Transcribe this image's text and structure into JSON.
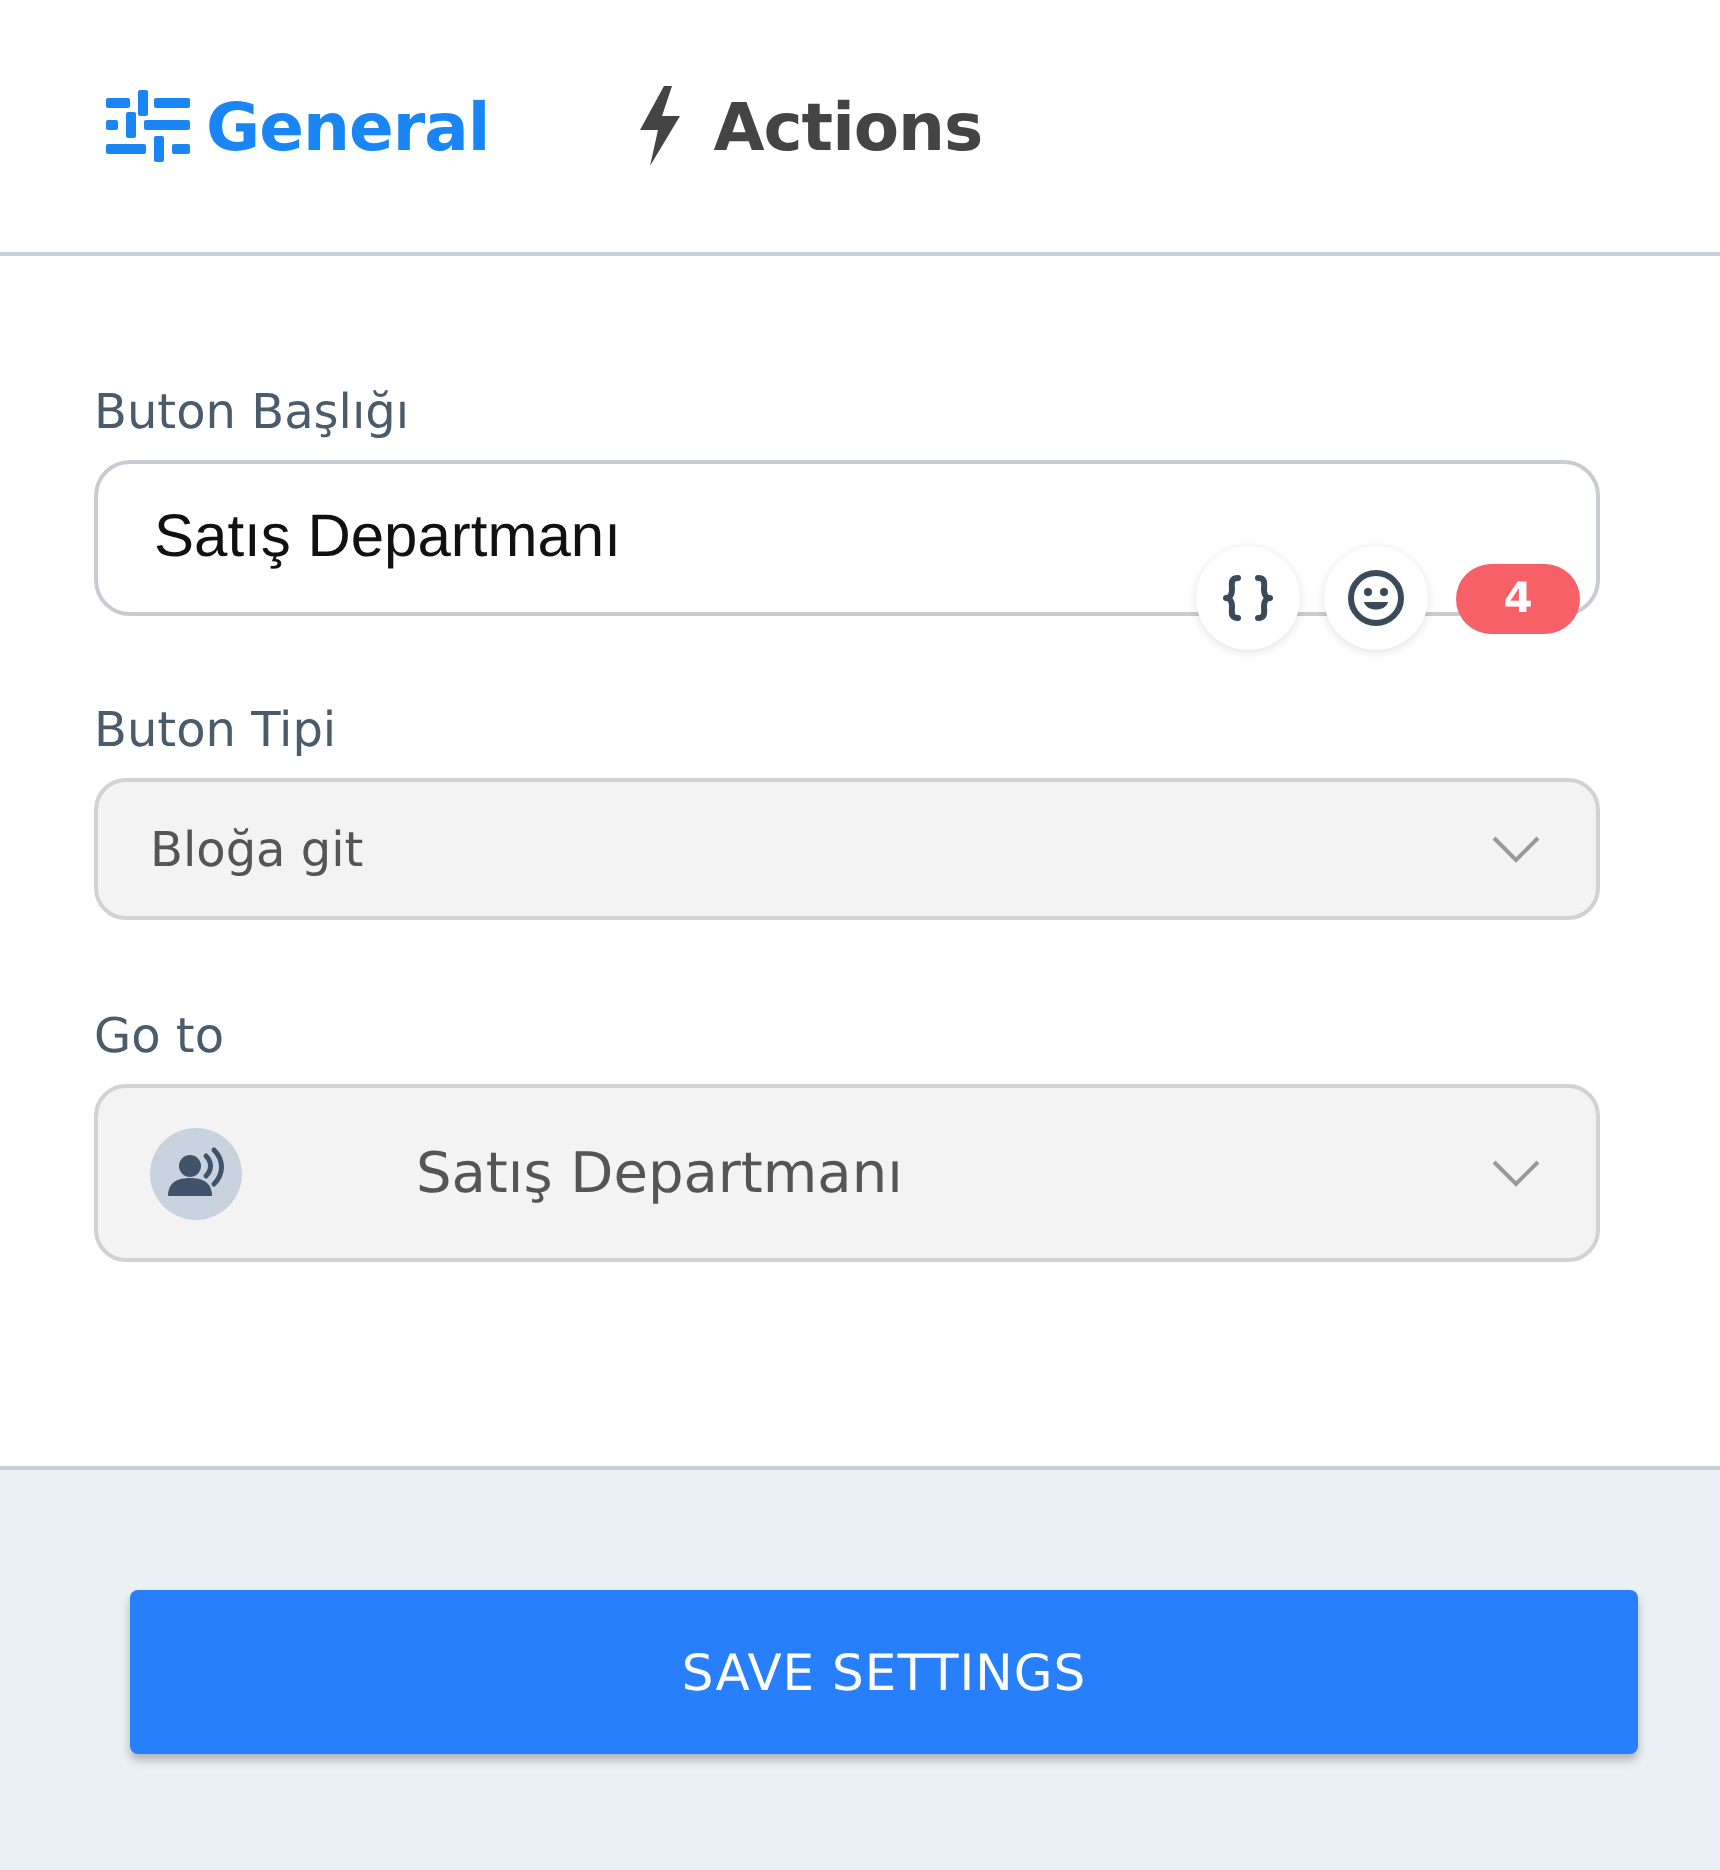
{
  "tabs": [
    {
      "label": "General",
      "selected": true
    },
    {
      "label": "Actions",
      "selected": false
    }
  ],
  "fields": [
    {
      "kind": "text",
      "label": "Buton Başlığı",
      "value": "Satış Departmanı",
      "counter": "4"
    },
    {
      "kind": "select",
      "label": "Buton Tipi",
      "value": "Bloğa git"
    },
    {
      "kind": "select-avatar",
      "label": "Go to",
      "value": "Satış Departmanı"
    }
  ],
  "save_button": {
    "label": "SAVE SETTINGS"
  }
}
